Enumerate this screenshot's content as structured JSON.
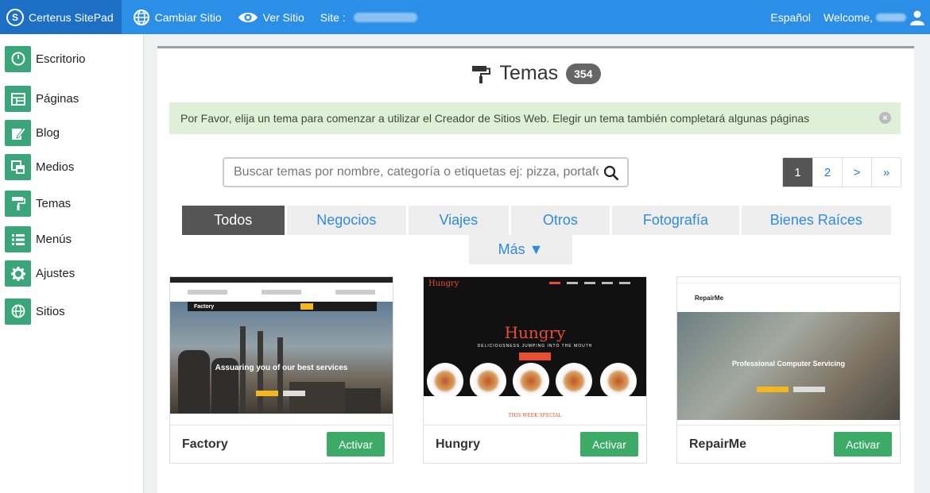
{
  "topbar": {
    "brand": "Certerus SitePad",
    "change_site": "Cambiar Sitio",
    "view_site": "Ver Sitio",
    "site_label": "Site :",
    "language": "Español",
    "welcome": "Welcome,"
  },
  "sidebar": {
    "items": [
      {
        "label": "Escritorio",
        "icon": "dashboard-icon"
      },
      {
        "label": "Páginas",
        "icon": "pages-icon"
      },
      {
        "label": "Blog",
        "icon": "blog-icon"
      },
      {
        "label": "Medios",
        "icon": "media-icon"
      },
      {
        "label": "Temas",
        "icon": "paint-roller-icon"
      },
      {
        "label": "Menús",
        "icon": "menu-icon"
      },
      {
        "label": "Ajustes",
        "icon": "gear-icon"
      },
      {
        "label": "Sitios",
        "icon": "globe-icon"
      }
    ]
  },
  "main": {
    "title": "Temas",
    "count": "354",
    "notice": "Por Favor, elija un tema para comenzar a utilizar el Creador de Sitios Web. Elegir un tema también completará algunas páginas",
    "notice_close": "×",
    "search_placeholder": "Buscar temas por nombre, categoría o etiquetas ej: pizza, portafolio, agencia",
    "pagination": [
      "1",
      "2",
      ">",
      "»"
    ],
    "tabs": [
      "Todos",
      "Negocios",
      "Viajes",
      "Otros",
      "Fotografía",
      "Bienes Raíces"
    ],
    "tab_more": "Más ▼",
    "themes": [
      {
        "name": "Factory",
        "action": "Activar",
        "preview": {
          "logo": "Factory",
          "headline": "Assuaring you of our best services"
        }
      },
      {
        "name": "Hungry",
        "action": "Activar",
        "preview": {
          "logo": "Hungry",
          "headline": "Hungry",
          "subline": "DELICIOUSNESS JUMPING INTO THE MOUTH",
          "special": "THIS WEEK SPECIAL"
        }
      },
      {
        "name": "RepairMe",
        "action": "Activar",
        "preview": {
          "logo": "RepairMe",
          "headline": "Professional Computer Servicing"
        }
      }
    ]
  },
  "colors": {
    "topbar": "#2b8fe8",
    "brand_bg": "#1c6fc4",
    "sidebar_icon": "#3aa57a",
    "activate_button": "#3dab68",
    "link": "#2e8be0",
    "notice_bg": "#dff0d8"
  }
}
